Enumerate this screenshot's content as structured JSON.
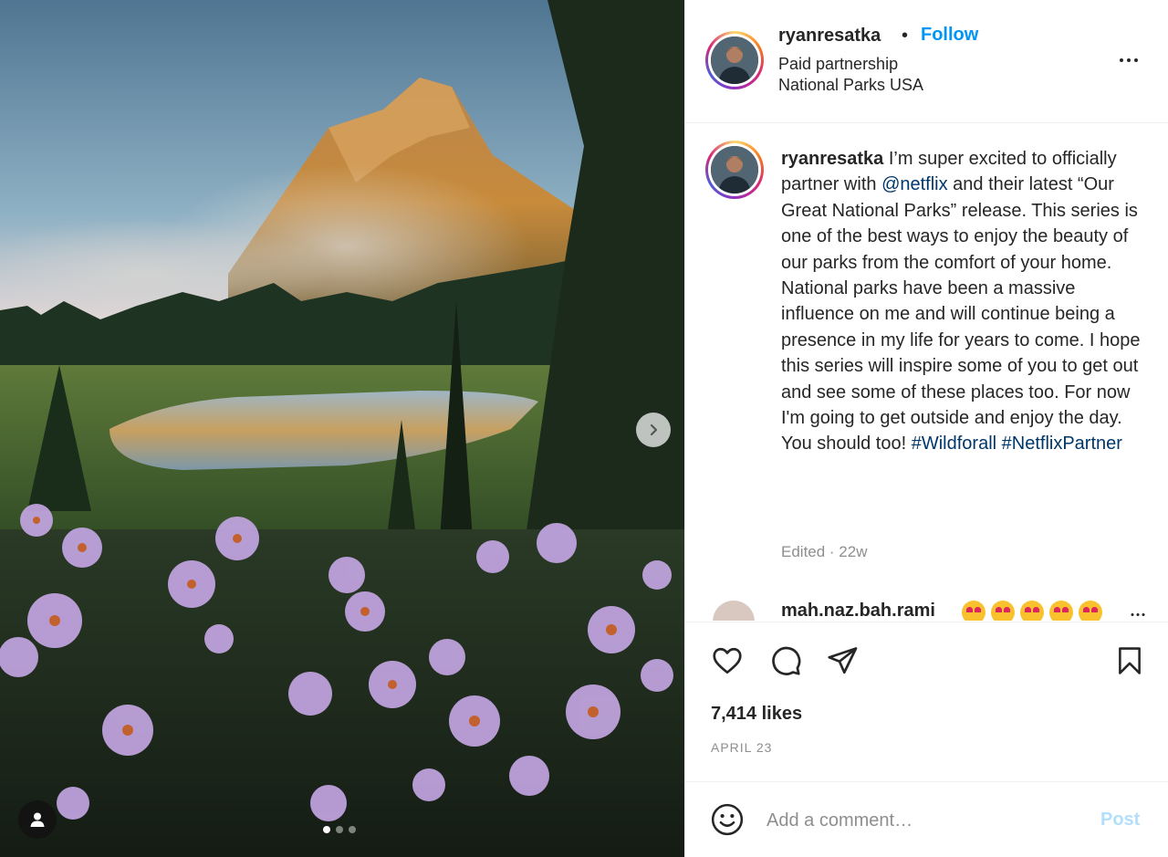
{
  "post": {
    "photo": {
      "carousel_dots": 3,
      "active_dot": 0,
      "next_icon": "chevron-right-icon",
      "tag_icon": "user-tag-icon"
    },
    "header": {
      "username": "ryanresatka",
      "separator": "•",
      "follow_label": "Follow",
      "subtitle_1": "Paid partnership",
      "subtitle_2": "National Parks USA",
      "more_icon": "more-options-icon"
    },
    "caption": {
      "username": "ryanresatka",
      "text_1": " I’m super excited to officially partner with ",
      "mention": "@netflix",
      "text_2": " and their latest “Our Great National Parks” release. This series is one of the best ways to enjoy the beauty of our parks from the comfort of your home. National parks have been a massive influence on me and will continue being a presence in my life for years to come. I hope this series will inspire some of you to get out and see some of these places too. For now I'm going to get outside and enjoy the day. You should too! ",
      "hashtag_1": "#Wildforall",
      "hashtag_2": "#NetflixPartner",
      "meta": "Edited · 22w"
    },
    "peek_comment": {
      "username": "mah.naz.bah.rami"
    },
    "actions": {
      "like_icon": "heart-icon",
      "comment_icon": "comment-icon",
      "share_icon": "send-icon",
      "save_icon": "bookmark-icon",
      "likes": "7,414 likes",
      "date": "APRIL 23"
    },
    "comment_box": {
      "emoji_icon": "smiley-icon",
      "placeholder": "Add a comment…",
      "post_label": "Post"
    },
    "colors": {
      "link_blue": "#0095f6",
      "mention_blue": "#00376b",
      "muted": "#8e8e8e",
      "post_disabled": "#b2dffc"
    }
  }
}
